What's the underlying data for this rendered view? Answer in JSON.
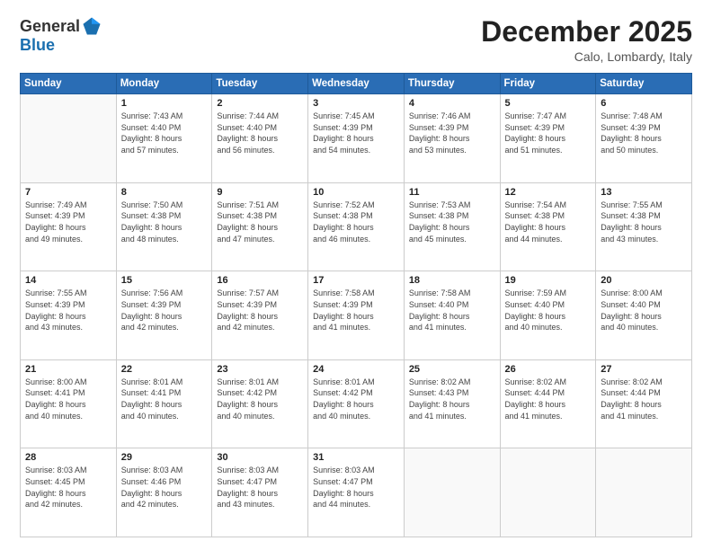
{
  "logo": {
    "general": "General",
    "blue": "Blue"
  },
  "title": "December 2025",
  "location": "Calo, Lombardy, Italy",
  "days_of_week": [
    "Sunday",
    "Monday",
    "Tuesday",
    "Wednesday",
    "Thursday",
    "Friday",
    "Saturday"
  ],
  "weeks": [
    [
      {
        "day": "",
        "info": ""
      },
      {
        "day": "1",
        "info": "Sunrise: 7:43 AM\nSunset: 4:40 PM\nDaylight: 8 hours\nand 57 minutes."
      },
      {
        "day": "2",
        "info": "Sunrise: 7:44 AM\nSunset: 4:40 PM\nDaylight: 8 hours\nand 56 minutes."
      },
      {
        "day": "3",
        "info": "Sunrise: 7:45 AM\nSunset: 4:39 PM\nDaylight: 8 hours\nand 54 minutes."
      },
      {
        "day": "4",
        "info": "Sunrise: 7:46 AM\nSunset: 4:39 PM\nDaylight: 8 hours\nand 53 minutes."
      },
      {
        "day": "5",
        "info": "Sunrise: 7:47 AM\nSunset: 4:39 PM\nDaylight: 8 hours\nand 51 minutes."
      },
      {
        "day": "6",
        "info": "Sunrise: 7:48 AM\nSunset: 4:39 PM\nDaylight: 8 hours\nand 50 minutes."
      }
    ],
    [
      {
        "day": "7",
        "info": "Sunrise: 7:49 AM\nSunset: 4:39 PM\nDaylight: 8 hours\nand 49 minutes."
      },
      {
        "day": "8",
        "info": "Sunrise: 7:50 AM\nSunset: 4:38 PM\nDaylight: 8 hours\nand 48 minutes."
      },
      {
        "day": "9",
        "info": "Sunrise: 7:51 AM\nSunset: 4:38 PM\nDaylight: 8 hours\nand 47 minutes."
      },
      {
        "day": "10",
        "info": "Sunrise: 7:52 AM\nSunset: 4:38 PM\nDaylight: 8 hours\nand 46 minutes."
      },
      {
        "day": "11",
        "info": "Sunrise: 7:53 AM\nSunset: 4:38 PM\nDaylight: 8 hours\nand 45 minutes."
      },
      {
        "day": "12",
        "info": "Sunrise: 7:54 AM\nSunset: 4:38 PM\nDaylight: 8 hours\nand 44 minutes."
      },
      {
        "day": "13",
        "info": "Sunrise: 7:55 AM\nSunset: 4:38 PM\nDaylight: 8 hours\nand 43 minutes."
      }
    ],
    [
      {
        "day": "14",
        "info": "Sunrise: 7:55 AM\nSunset: 4:39 PM\nDaylight: 8 hours\nand 43 minutes."
      },
      {
        "day": "15",
        "info": "Sunrise: 7:56 AM\nSunset: 4:39 PM\nDaylight: 8 hours\nand 42 minutes."
      },
      {
        "day": "16",
        "info": "Sunrise: 7:57 AM\nSunset: 4:39 PM\nDaylight: 8 hours\nand 42 minutes."
      },
      {
        "day": "17",
        "info": "Sunrise: 7:58 AM\nSunset: 4:39 PM\nDaylight: 8 hours\nand 41 minutes."
      },
      {
        "day": "18",
        "info": "Sunrise: 7:58 AM\nSunset: 4:40 PM\nDaylight: 8 hours\nand 41 minutes."
      },
      {
        "day": "19",
        "info": "Sunrise: 7:59 AM\nSunset: 4:40 PM\nDaylight: 8 hours\nand 40 minutes."
      },
      {
        "day": "20",
        "info": "Sunrise: 8:00 AM\nSunset: 4:40 PM\nDaylight: 8 hours\nand 40 minutes."
      }
    ],
    [
      {
        "day": "21",
        "info": "Sunrise: 8:00 AM\nSunset: 4:41 PM\nDaylight: 8 hours\nand 40 minutes."
      },
      {
        "day": "22",
        "info": "Sunrise: 8:01 AM\nSunset: 4:41 PM\nDaylight: 8 hours\nand 40 minutes."
      },
      {
        "day": "23",
        "info": "Sunrise: 8:01 AM\nSunset: 4:42 PM\nDaylight: 8 hours\nand 40 minutes."
      },
      {
        "day": "24",
        "info": "Sunrise: 8:01 AM\nSunset: 4:42 PM\nDaylight: 8 hours\nand 40 minutes."
      },
      {
        "day": "25",
        "info": "Sunrise: 8:02 AM\nSunset: 4:43 PM\nDaylight: 8 hours\nand 41 minutes."
      },
      {
        "day": "26",
        "info": "Sunrise: 8:02 AM\nSunset: 4:44 PM\nDaylight: 8 hours\nand 41 minutes."
      },
      {
        "day": "27",
        "info": "Sunrise: 8:02 AM\nSunset: 4:44 PM\nDaylight: 8 hours\nand 41 minutes."
      }
    ],
    [
      {
        "day": "28",
        "info": "Sunrise: 8:03 AM\nSunset: 4:45 PM\nDaylight: 8 hours\nand 42 minutes."
      },
      {
        "day": "29",
        "info": "Sunrise: 8:03 AM\nSunset: 4:46 PM\nDaylight: 8 hours\nand 42 minutes."
      },
      {
        "day": "30",
        "info": "Sunrise: 8:03 AM\nSunset: 4:47 PM\nDaylight: 8 hours\nand 43 minutes."
      },
      {
        "day": "31",
        "info": "Sunrise: 8:03 AM\nSunset: 4:47 PM\nDaylight: 8 hours\nand 44 minutes."
      },
      {
        "day": "",
        "info": ""
      },
      {
        "day": "",
        "info": ""
      },
      {
        "day": "",
        "info": ""
      }
    ]
  ]
}
